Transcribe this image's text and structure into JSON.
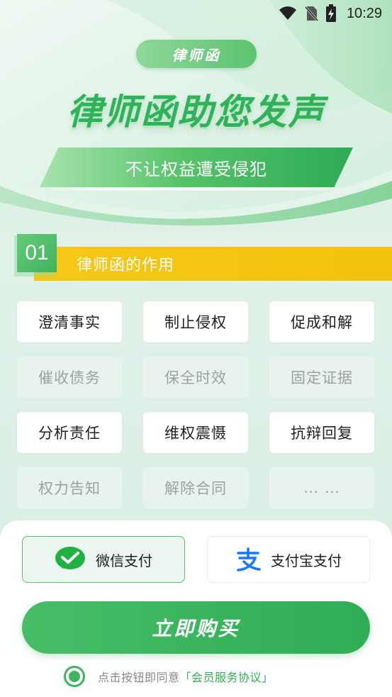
{
  "status_bar": {
    "time": "10:29",
    "icons": [
      "wifi-icon",
      "no-sim-icon",
      "battery-charging-icon"
    ]
  },
  "hero": {
    "badge": "律师函",
    "headline": "律师函助您发声",
    "subtitle": "不让权益遭受侵犯"
  },
  "section": {
    "number": "01",
    "title": "律师函的作用"
  },
  "functions": [
    {
      "label": "澄清事实",
      "state": "active"
    },
    {
      "label": "制止侵权",
      "state": "active"
    },
    {
      "label": "促成和解",
      "state": "active"
    },
    {
      "label": "催收债务",
      "state": "muted"
    },
    {
      "label": "保全时效",
      "state": "muted"
    },
    {
      "label": "固定证据",
      "state": "muted"
    },
    {
      "label": "分析责任",
      "state": "active"
    },
    {
      "label": "维权震慑",
      "state": "active"
    },
    {
      "label": "抗辩回复",
      "state": "active"
    },
    {
      "label": "权力告知",
      "state": "muted"
    },
    {
      "label": "解除合同",
      "state": "muted"
    },
    {
      "label": "… …",
      "state": "muted"
    }
  ],
  "payment": {
    "wechat_label": "微信支付",
    "alipay_label": "支付宝支付",
    "selected": "wechat"
  },
  "buy_button": "立即购买",
  "agreement": {
    "prefix": "点击按钮即同意",
    "link": "「会员服务协议」"
  },
  "colors": {
    "primary_green": "#2fae55",
    "accent_yellow": "#f5c818",
    "wechat_green": "#21b143",
    "alipay_blue": "#1677ff"
  }
}
